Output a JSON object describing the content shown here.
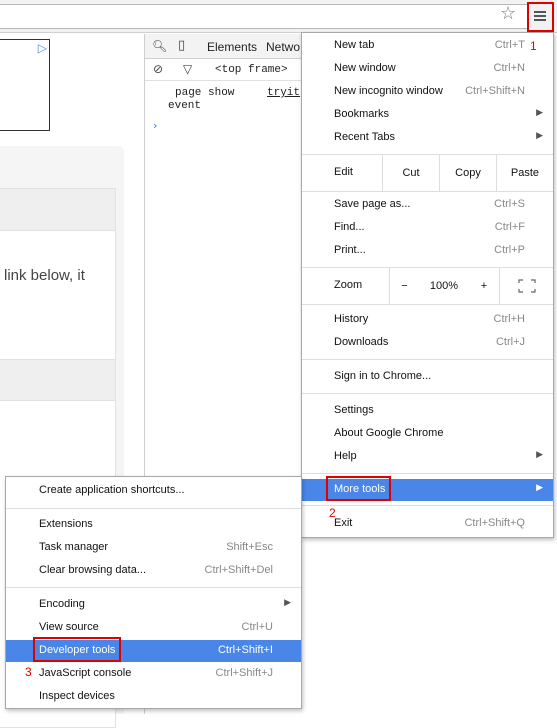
{
  "toolbar": {
    "star_icon": "star-icon",
    "menu_icon": "hamburger-menu-icon"
  },
  "page": {
    "ad_icon": "adchoices-icon",
    "body_text": "link below, it"
  },
  "devtools": {
    "tabs": [
      "Elements",
      "Netwo"
    ],
    "frame_selector": "<top frame>",
    "console_line1": "page show",
    "console_link": "tryit",
    "console_line2": "event",
    "prompt": "›"
  },
  "main_menu": {
    "new_tab": {
      "label": "New tab",
      "shortcut": "Ctrl+T"
    },
    "new_window": {
      "label": "New window",
      "shortcut": "Ctrl+N"
    },
    "new_incognito": {
      "label": "New incognito window",
      "shortcut": "Ctrl+Shift+N"
    },
    "bookmarks": {
      "label": "Bookmarks"
    },
    "recent_tabs": {
      "label": "Recent Tabs"
    },
    "edit": {
      "label": "Edit",
      "cut": "Cut",
      "copy": "Copy",
      "paste": "Paste"
    },
    "save_page": {
      "label": "Save page as...",
      "shortcut": "Ctrl+S"
    },
    "find": {
      "label": "Find...",
      "shortcut": "Ctrl+F"
    },
    "print": {
      "label": "Print...",
      "shortcut": "Ctrl+P"
    },
    "zoom": {
      "label": "Zoom",
      "minus": "−",
      "value": "100%",
      "plus": "+"
    },
    "history": {
      "label": "History",
      "shortcut": "Ctrl+H"
    },
    "downloads": {
      "label": "Downloads",
      "shortcut": "Ctrl+J"
    },
    "sign_in": {
      "label": "Sign in to Chrome..."
    },
    "settings": {
      "label": "Settings"
    },
    "about": {
      "label": "About Google Chrome"
    },
    "help": {
      "label": "Help"
    },
    "more_tools": {
      "label": "More tools"
    },
    "exit": {
      "label": "Exit",
      "shortcut": "Ctrl+Shift+Q"
    }
  },
  "sub_menu": {
    "create_shortcuts": {
      "label": "Create application shortcuts..."
    },
    "extensions": {
      "label": "Extensions"
    },
    "task_manager": {
      "label": "Task manager",
      "shortcut": "Shift+Esc"
    },
    "clear_data": {
      "label": "Clear browsing data...",
      "shortcut": "Ctrl+Shift+Del"
    },
    "encoding": {
      "label": "Encoding"
    },
    "view_source": {
      "label": "View source",
      "shortcut": "Ctrl+U"
    },
    "developer_tools": {
      "label": "Developer tools",
      "shortcut": "Ctrl+Shift+I"
    },
    "js_console": {
      "label": "JavaScript console",
      "shortcut": "Ctrl+Shift+J"
    },
    "inspect_devices": {
      "label": "Inspect devices"
    }
  },
  "annotations": {
    "step1": "1",
    "step2": "2",
    "step3": "3"
  },
  "colors": {
    "highlight": "#4a86e8",
    "annotation": "#e00000"
  }
}
